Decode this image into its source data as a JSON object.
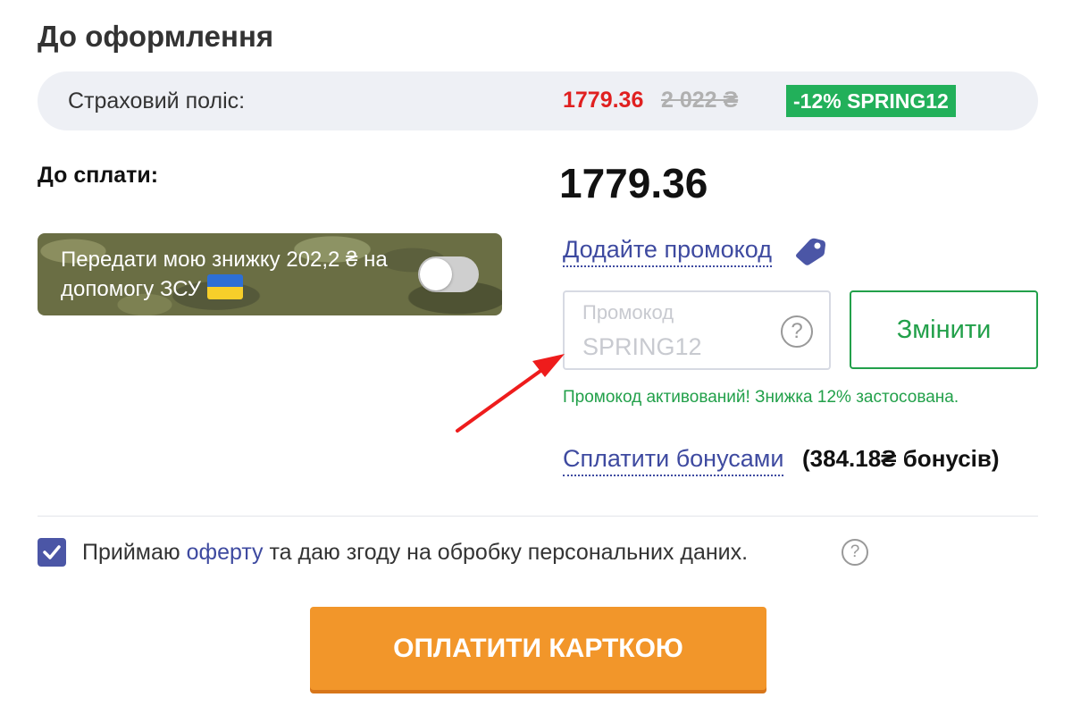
{
  "page": {
    "title": "До оформлення"
  },
  "policy": {
    "label": "Страховий поліс:",
    "price_new": "1779.36",
    "price_old": "2 022 ₴",
    "discount_badge": "-12% SPRING12"
  },
  "payment": {
    "label": "До сплати:",
    "total": "1779.36"
  },
  "zsu": {
    "text": "Передати мою знижку 202,2 ₴ на допомогу ЗСУ",
    "toggle_on": false,
    "flag_colors": [
      "#2d6fd6",
      "#f7cf2a"
    ]
  },
  "promo": {
    "link_label": "Додайте промокод",
    "placeholder": "Промокод",
    "value": "SPRING12",
    "help_symbol": "?",
    "change_label": "Змінити",
    "success_message": "Промокод активований! Знижка 12% застосована."
  },
  "bonus": {
    "link_label": "Сплатити бонусами",
    "amount": "(384.18₴ бонусів)"
  },
  "consent": {
    "checked": true,
    "text_before": "Приймаю ",
    "link_label": "оферту",
    "text_after": " та даю згоду на обробку персональних даних.",
    "help_symbol": "?"
  },
  "pay_button": {
    "label": "ОПЛАТИТИ КАРТКОЮ"
  },
  "colors": {
    "accent": "#3e4aa0",
    "success": "#22a04a",
    "price_red": "#e02020",
    "pay_orange": "#f2962a",
    "badge_green": "#22b05a"
  },
  "icons": [
    "tag-icon",
    "help-icon",
    "check-icon",
    "arrow-annotation"
  ]
}
